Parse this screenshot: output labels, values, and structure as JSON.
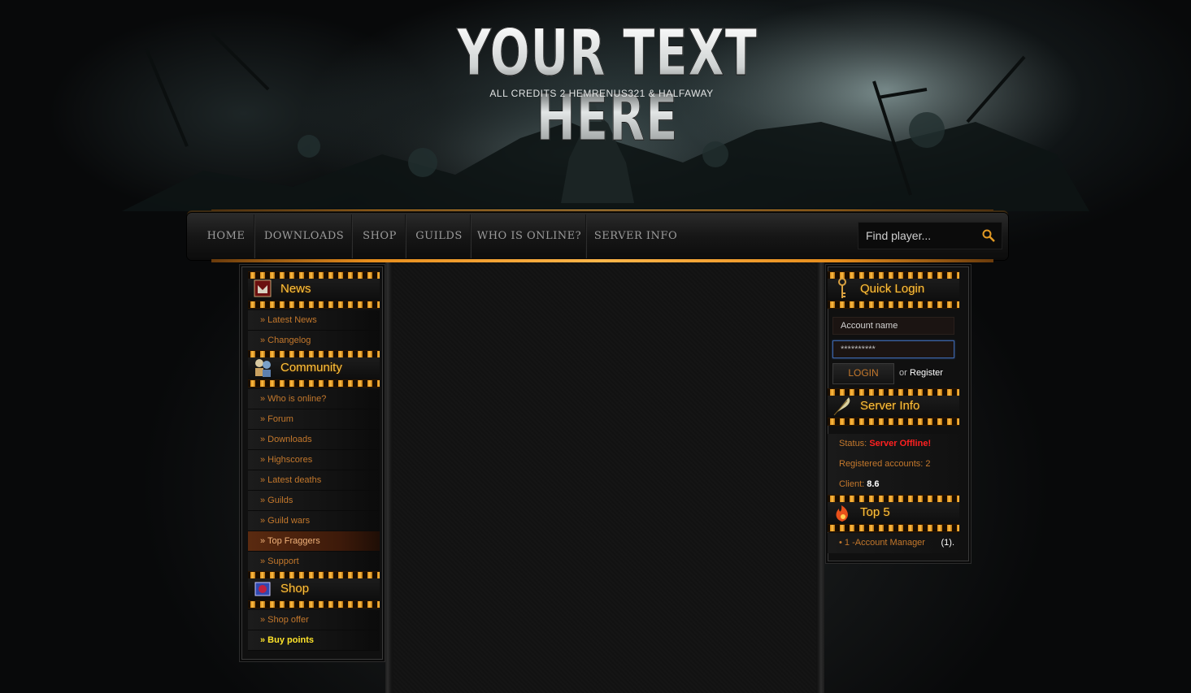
{
  "header": {
    "logo_text": "YOUR TEXT HERE",
    "credits": "ALL CREDITS  2 HEMRENUS321 & HALFAWAY"
  },
  "nav": {
    "items": [
      {
        "label": "HOME"
      },
      {
        "label": "DOWNLOADS"
      },
      {
        "label": "SHOP"
      },
      {
        "label": "GUILDS"
      },
      {
        "label": "WHO IS ONLINE?"
      },
      {
        "label": "SERVER INFO"
      }
    ],
    "search_placeholder": "Find player..."
  },
  "sidebar": {
    "news": {
      "title": "News",
      "items": [
        "» Latest News",
        "» Changelog"
      ]
    },
    "community": {
      "title": "Community",
      "items": [
        "» Who is online?",
        "» Forum",
        "» Downloads",
        "» Highscores",
        "» Latest deaths",
        "» Guilds",
        "» Guild wars",
        "» Top Fraggers",
        "» Support"
      ],
      "active_index": 7
    },
    "shop": {
      "title": "Shop",
      "items": [
        "» Shop offer",
        "» Buy points"
      ]
    }
  },
  "quick_login": {
    "title": "Quick Login",
    "account_placeholder": "Account name",
    "password_value": "**********",
    "login_label": "LOGIN",
    "or_text": "or",
    "register_label": "Register"
  },
  "server_info": {
    "title": "Server Info",
    "status_label": "Status:",
    "status_value": "Server Offline!",
    "registered_accounts": "Registered accounts: 2",
    "client_label": "Client:",
    "client_value": "8.6"
  },
  "top5": {
    "title": "Top 5",
    "rows": [
      {
        "name": "• 1 -Account Manager",
        "score": "1",
        "score_text": "(1)."
      }
    ]
  },
  "colors": {
    "accent_gold": "#ffc23a",
    "link_orange": "#c4782c",
    "status_red": "#ff2020",
    "highlight_yellow": "#ffe42a"
  }
}
